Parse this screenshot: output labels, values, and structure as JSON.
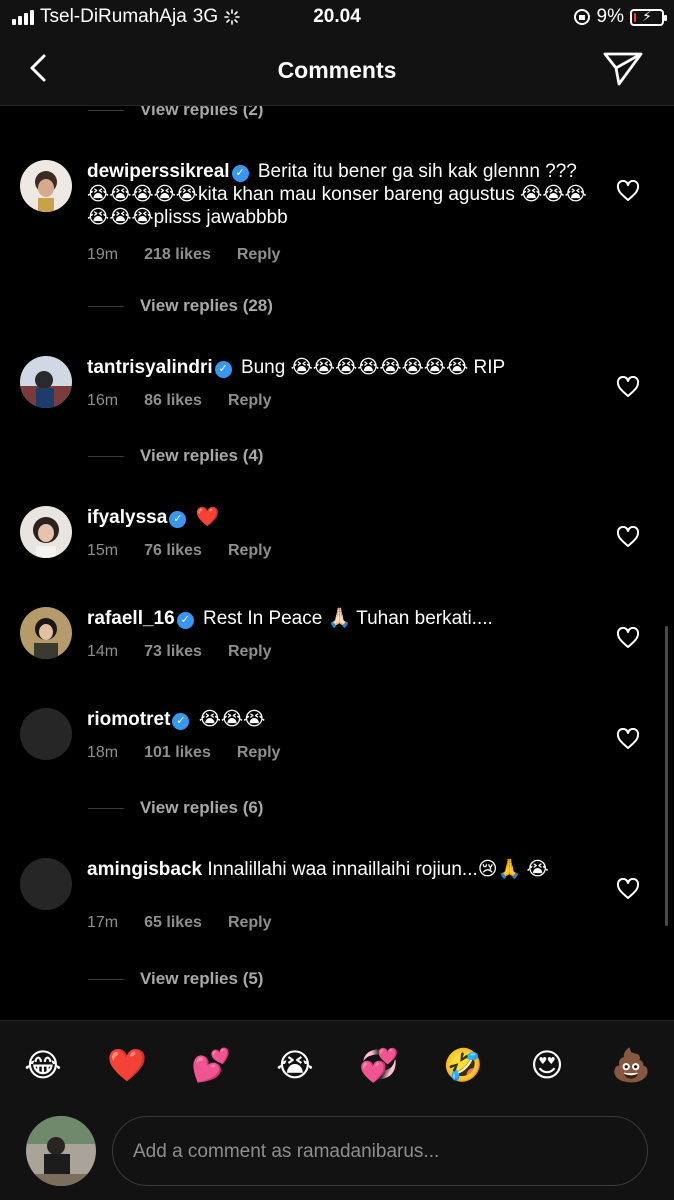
{
  "status_bar": {
    "carrier": "Tsel-DiRumahAja",
    "network": "3G",
    "time": "20.04",
    "battery": "9%",
    "battery_level": 0.09
  },
  "header": {
    "title": "Comments"
  },
  "top_view_replies": "View replies (2)",
  "comments": [
    {
      "username": "dewiperssikreal",
      "verified": true,
      "text": "Berita itu bener ga sih kak glennn ??? 😭😭😭😭😭kita khan mau konser bareng agustus 😭😭😭😭😭😭plisss jawabbbb",
      "time": "19m",
      "likes": "218 likes",
      "reply": "Reply",
      "view_replies": "View replies (28)"
    },
    {
      "username": "tantrisyalindri",
      "verified": true,
      "text": "Bung 😭😭😭😭😭😭😭😭 RIP",
      "time": "16m",
      "likes": "86 likes",
      "reply": "Reply",
      "view_replies": "View replies (4)"
    },
    {
      "username": "ifyalyssa",
      "verified": true,
      "text": "❤️",
      "time": "15m",
      "likes": "76 likes",
      "reply": "Reply",
      "view_replies": ""
    },
    {
      "username": "rafaell_16",
      "verified": true,
      "text": "Rest In Peace 🙏🏻 Tuhan berkati....",
      "time": "14m",
      "likes": "73 likes",
      "reply": "Reply",
      "view_replies": ""
    },
    {
      "username": "riomotret",
      "verified": true,
      "text": "😭😭😭",
      "time": "18m",
      "likes": "101 likes",
      "reply": "Reply",
      "view_replies": "View replies (6)"
    },
    {
      "username": "amingisback",
      "verified": false,
      "text": "Innalillahi waa innaillaihi rojiun...😢🙏 😭",
      "time": "17m",
      "likes": "65 likes",
      "reply": "Reply",
      "view_replies": "View replies (5)"
    }
  ],
  "emoji_bar": [
    "😂",
    "❤️",
    "💕",
    "😭",
    "💞",
    "🤣",
    "😍",
    "💩"
  ],
  "composer": {
    "placeholder": "Add a comment as ramadanibarus..."
  },
  "icons": {
    "back": "chevron-left-icon",
    "send": "paper-plane-icon",
    "like": "heart-outline-icon",
    "verified": "verified-badge-icon"
  },
  "colors": {
    "background": "#000000",
    "bar_background": "#121212",
    "muted_text": "#8e8e8e",
    "verified_blue": "#3897f0"
  }
}
